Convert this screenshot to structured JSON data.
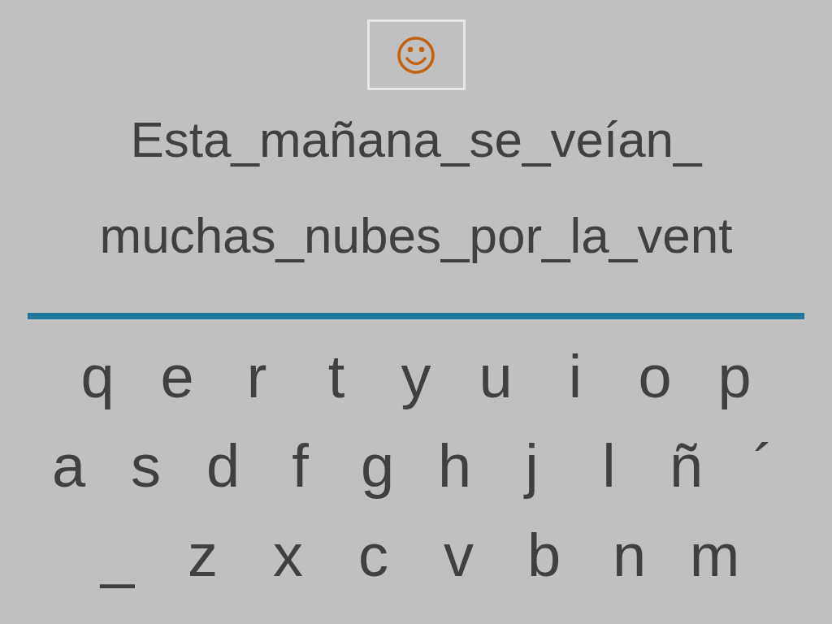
{
  "sentence_lines": [
    "Esta_mañana_se_veían_",
    "muchas_nubes_por_la_vent"
  ],
  "keyboard": {
    "rows": [
      [
        "q",
        "e",
        "r",
        "t",
        "y",
        "u",
        "i",
        "o",
        "p"
      ],
      [
        "a",
        "s",
        "d",
        "f",
        "g",
        "h",
        "j",
        "l",
        "ñ",
        "´"
      ],
      [
        "_",
        "z",
        "x",
        "c",
        "v",
        "b",
        "n",
        "m"
      ]
    ]
  }
}
